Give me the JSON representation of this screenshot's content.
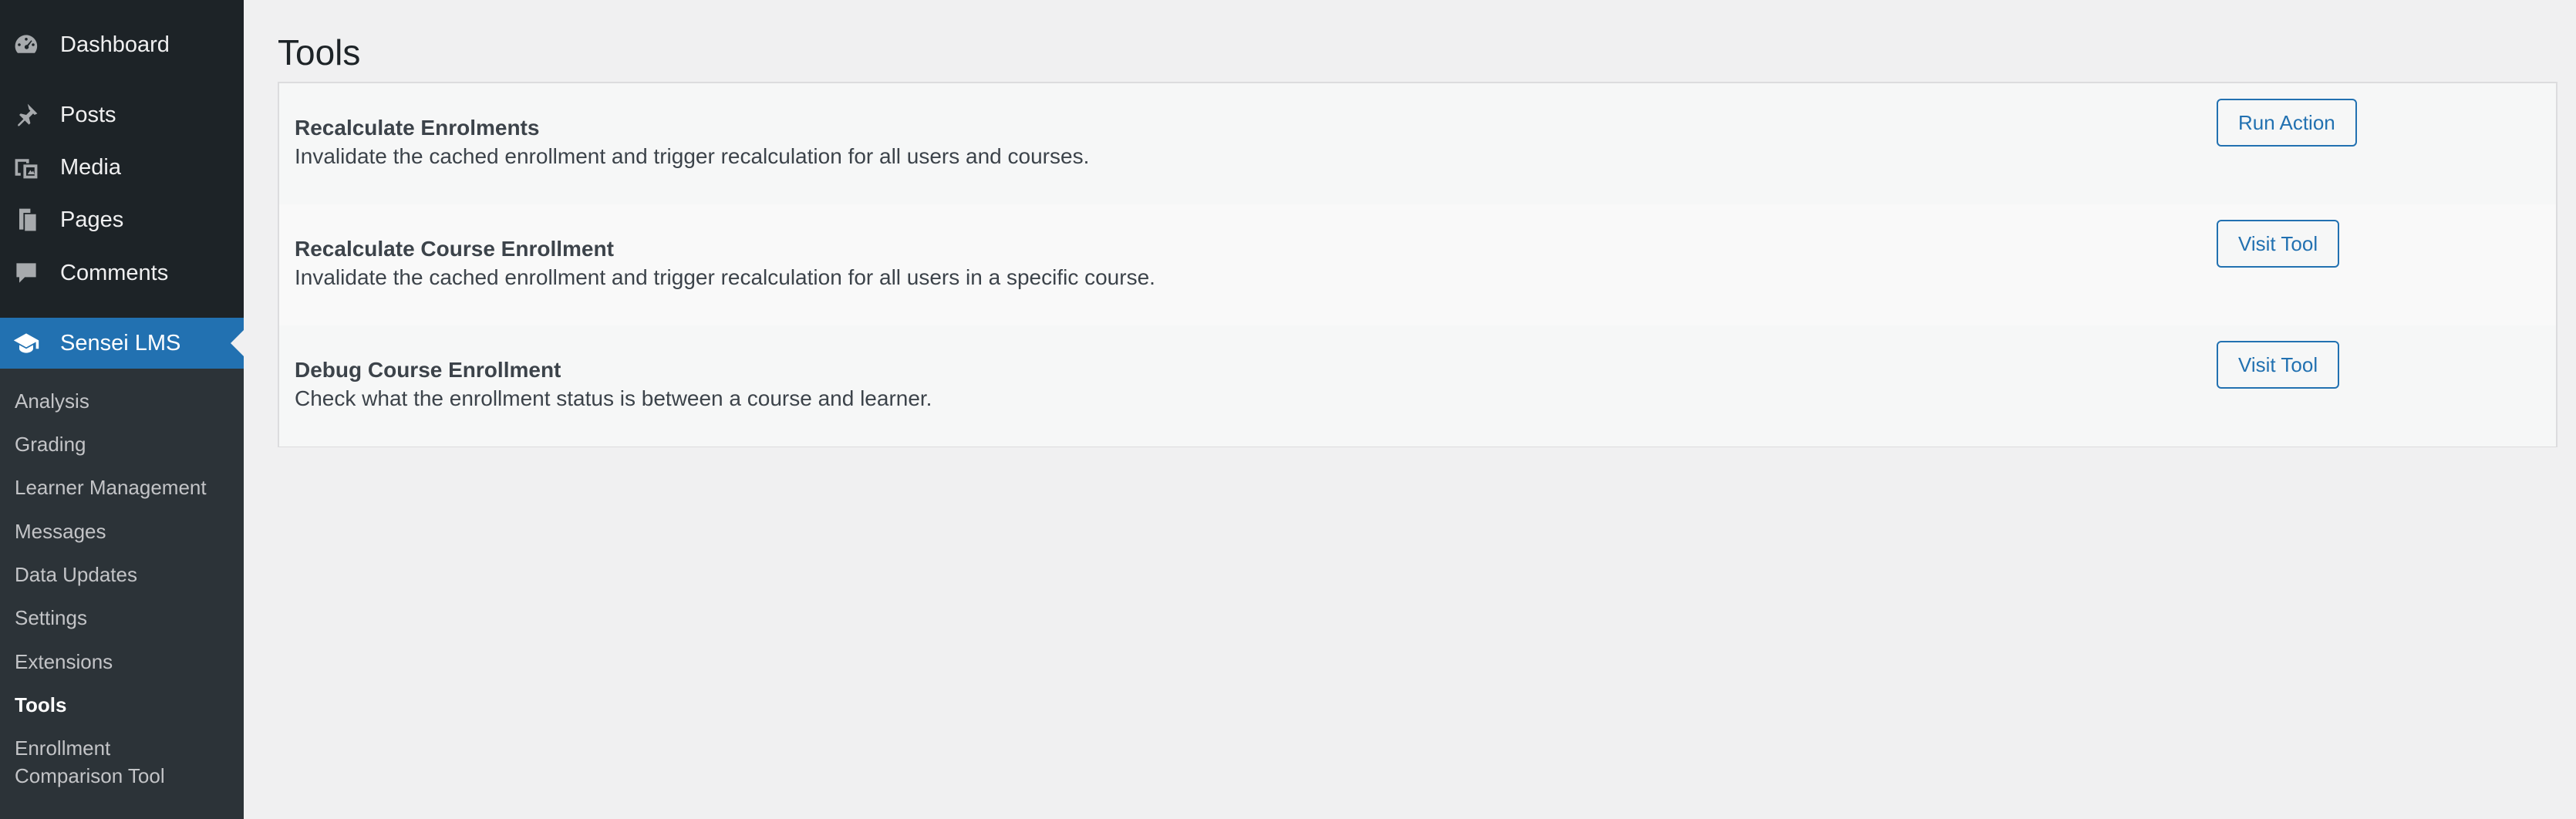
{
  "sidebar": {
    "menu": [
      {
        "label": "Dashboard",
        "icon": "dashboard-icon"
      },
      {
        "label": "Posts",
        "icon": "pushpin-icon"
      },
      {
        "label": "Media",
        "icon": "media-icon"
      },
      {
        "label": "Pages",
        "icon": "pages-icon"
      },
      {
        "label": "Comments",
        "icon": "comment-icon"
      },
      {
        "label": "Sensei LMS",
        "icon": "graduation-cap-icon"
      }
    ],
    "submenu": [
      {
        "label": "Analysis"
      },
      {
        "label": "Grading"
      },
      {
        "label": "Learner Management"
      },
      {
        "label": "Messages"
      },
      {
        "label": "Data Updates"
      },
      {
        "label": "Settings"
      },
      {
        "label": "Extensions"
      },
      {
        "label": "Tools"
      },
      {
        "label": "Enrollment Comparison Tool"
      }
    ]
  },
  "main": {
    "title": "Tools",
    "tools": [
      {
        "title": "Recalculate Enrolments",
        "description": "Invalidate the cached enrollment and trigger recalculation for all users and courses.",
        "button": "Run Action"
      },
      {
        "title": "Recalculate Course Enrollment",
        "description": "Invalidate the cached enrollment and trigger recalculation for all users in a specific course.",
        "button": "Visit Tool"
      },
      {
        "title": "Debug Course Enrollment",
        "description": "Check what the enrollment status is between a course and learner.",
        "button": "Visit Tool"
      }
    ]
  },
  "colors": {
    "sidebar_bg": "#1d2327",
    "submenu_bg": "#2c3338",
    "accent": "#2271b1",
    "page_bg": "#f0f0f1"
  }
}
